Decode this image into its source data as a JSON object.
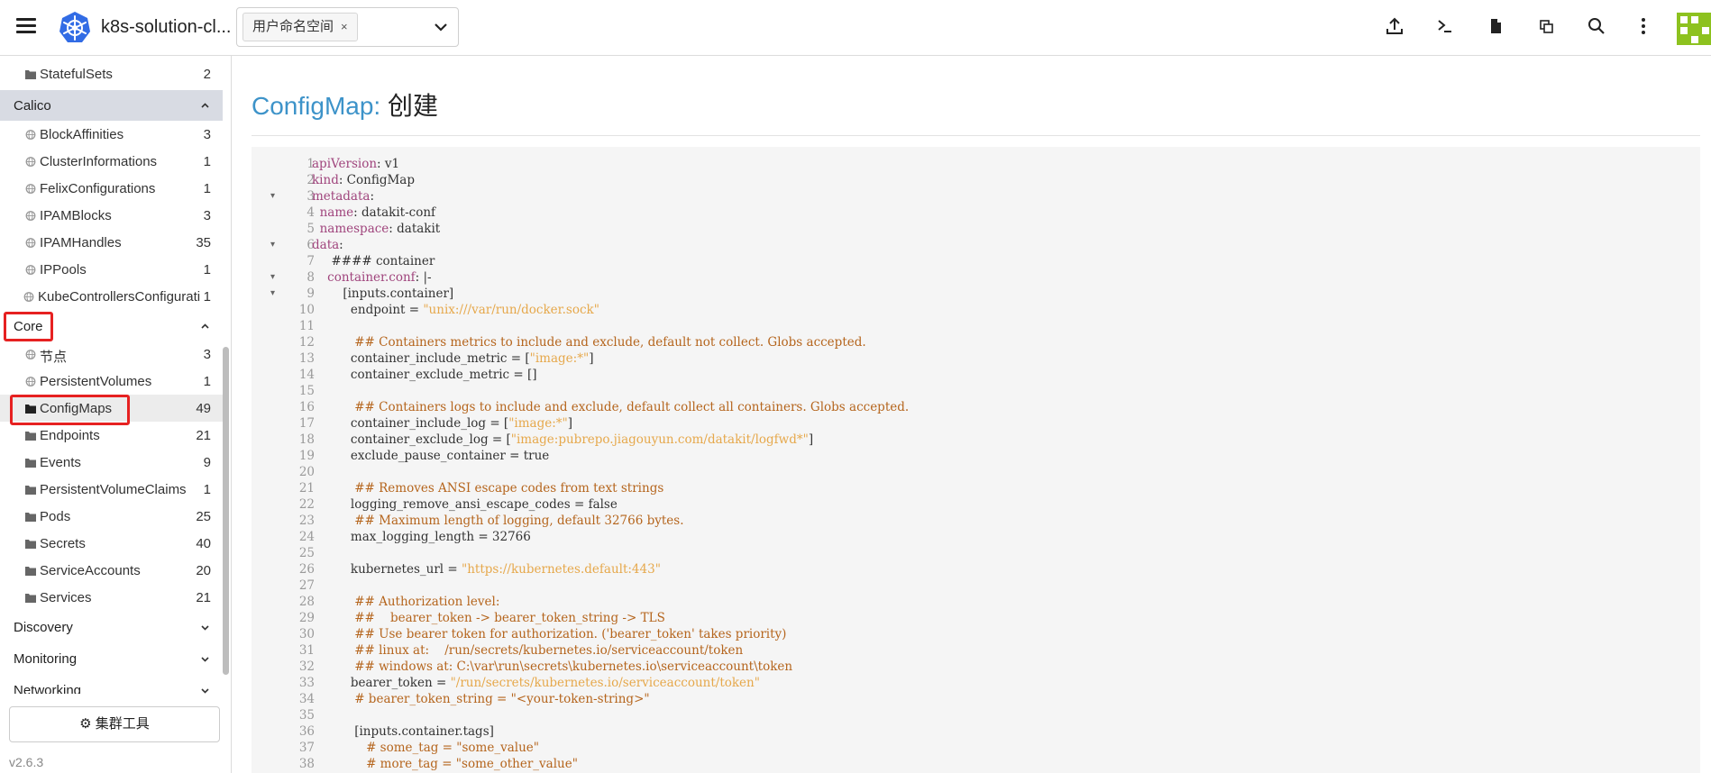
{
  "header": {
    "cluster_name": "k8s-solution-cl...",
    "namespace_chip": "用户命名空间",
    "chip_remove": "×"
  },
  "icons": {
    "menu": "hamburger-icon",
    "logo": "kubernetes-logo-icon",
    "upload": "upload-icon",
    "terminal": "terminal-icon",
    "file": "file-icon",
    "copy": "copy-icon",
    "search": "search-icon",
    "more": "more-vertical-icon"
  },
  "colors": {
    "accent": "#3d93c9",
    "highlight_box": "#e62121",
    "group_highlight": "#d8dbe3",
    "brand_tile": "#8dc21f"
  },
  "sidebar": {
    "top_item": {
      "label": "StatefulSets",
      "count": "2"
    },
    "groups": [
      {
        "label": "Calico",
        "items": [
          {
            "label": "BlockAffinities",
            "count": "3"
          },
          {
            "label": "ClusterInformations",
            "count": "1"
          },
          {
            "label": "FelixConfigurations",
            "count": "1"
          },
          {
            "label": "IPAMBlocks",
            "count": "3"
          },
          {
            "label": "IPAMHandles",
            "count": "35"
          },
          {
            "label": "IPPools",
            "count": "1"
          },
          {
            "label": "KubeControllersConfigurati",
            "count": "1"
          }
        ]
      },
      {
        "label": "Core",
        "items": [
          {
            "label": "节点",
            "count": "3"
          },
          {
            "label": "PersistentVolumes",
            "count": "1"
          },
          {
            "label": "ConfigMaps",
            "count": "49"
          },
          {
            "label": "Endpoints",
            "count": "21"
          },
          {
            "label": "Events",
            "count": "9"
          },
          {
            "label": "PersistentVolumeClaims",
            "count": "1"
          },
          {
            "label": "Pods",
            "count": "25"
          },
          {
            "label": "Secrets",
            "count": "40"
          },
          {
            "label": "ServiceAccounts",
            "count": "20"
          },
          {
            "label": "Services",
            "count": "21"
          }
        ]
      },
      {
        "label": "Discovery"
      },
      {
        "label": "Monitoring"
      },
      {
        "label": "Networking"
      }
    ],
    "tools_button": "集群工具",
    "version": "v2.6.3"
  },
  "main": {
    "title_kind": "ConfigMap:",
    "title_action": "创建"
  },
  "editor": {
    "lines": [
      {
        "n": "1",
        "fold": "",
        "segs": [
          [
            "k",
            "apiVersion"
          ],
          [
            "t",
            ": v1"
          ]
        ]
      },
      {
        "n": "2",
        "fold": "",
        "segs": [
          [
            "k",
            "kind"
          ],
          [
            "t",
            ": ConfigMap"
          ]
        ]
      },
      {
        "n": "3",
        "fold": "▾",
        "segs": [
          [
            "k",
            "metadata"
          ],
          [
            "t",
            ":"
          ]
        ]
      },
      {
        "n": "4",
        "fold": "",
        "segs": [
          [
            "t",
            "  "
          ],
          [
            "k",
            "name"
          ],
          [
            "t",
            ": datakit-conf"
          ]
        ]
      },
      {
        "n": "5",
        "fold": "",
        "segs": [
          [
            "t",
            "  "
          ],
          [
            "k",
            "namespace"
          ],
          [
            "t",
            ": datakit"
          ]
        ]
      },
      {
        "n": "6",
        "fold": "▾",
        "segs": [
          [
            "k",
            "data"
          ],
          [
            "t",
            ":"
          ]
        ]
      },
      {
        "n": "7",
        "fold": "",
        "segs": [
          [
            "t",
            "     #### container"
          ]
        ]
      },
      {
        "n": "8",
        "fold": "▾",
        "segs": [
          [
            "t",
            "    "
          ],
          [
            "k",
            "container.conf"
          ],
          [
            "t",
            ": |-"
          ]
        ]
      },
      {
        "n": "9",
        "fold": "▾",
        "segs": [
          [
            "t",
            "        [inputs.container]"
          ]
        ]
      },
      {
        "n": "10",
        "fold": "",
        "segs": [
          [
            "t",
            "          endpoint = "
          ],
          [
            "s",
            "\"unix:///var/run/docker.sock\""
          ]
        ]
      },
      {
        "n": "11",
        "fold": "",
        "segs": [
          [
            "t",
            ""
          ]
        ]
      },
      {
        "n": "12",
        "fold": "",
        "segs": [
          [
            "c",
            "           ## Containers metrics to include and exclude, default not collect. Globs accepted."
          ]
        ]
      },
      {
        "n": "13",
        "fold": "",
        "segs": [
          [
            "t",
            "          container_include_metric = ["
          ],
          [
            "s",
            "\"image:*\""
          ],
          [
            "t",
            "]"
          ]
        ]
      },
      {
        "n": "14",
        "fold": "",
        "segs": [
          [
            "t",
            "          container_exclude_metric = []"
          ]
        ]
      },
      {
        "n": "15",
        "fold": "",
        "segs": [
          [
            "t",
            ""
          ]
        ]
      },
      {
        "n": "16",
        "fold": "",
        "segs": [
          [
            "c",
            "           ## Containers logs to include and exclude, default collect all containers. Globs accepted."
          ]
        ]
      },
      {
        "n": "17",
        "fold": "",
        "segs": [
          [
            "t",
            "          container_include_log = ["
          ],
          [
            "s",
            "\"image:*\""
          ],
          [
            "t",
            "]"
          ]
        ]
      },
      {
        "n": "18",
        "fold": "",
        "segs": [
          [
            "t",
            "          container_exclude_log = ["
          ],
          [
            "s",
            "\"image:pubrepo.jiagouyun.com/datakit/logfwd*\""
          ],
          [
            "t",
            "]"
          ]
        ]
      },
      {
        "n": "19",
        "fold": "",
        "segs": [
          [
            "t",
            "          exclude_pause_container = true"
          ]
        ]
      },
      {
        "n": "20",
        "fold": "",
        "segs": [
          [
            "t",
            ""
          ]
        ]
      },
      {
        "n": "21",
        "fold": "",
        "segs": [
          [
            "c",
            "           ## Removes ANSI escape codes from text strings"
          ]
        ]
      },
      {
        "n": "22",
        "fold": "",
        "segs": [
          [
            "t",
            "          logging_remove_ansi_escape_codes = false"
          ]
        ]
      },
      {
        "n": "23",
        "fold": "",
        "segs": [
          [
            "c",
            "           ## Maximum length of logging, default 32766 bytes."
          ]
        ]
      },
      {
        "n": "24",
        "fold": "",
        "segs": [
          [
            "t",
            "          max_logging_length = 32766"
          ]
        ]
      },
      {
        "n": "25",
        "fold": "",
        "segs": [
          [
            "t",
            ""
          ]
        ]
      },
      {
        "n": "26",
        "fold": "",
        "segs": [
          [
            "t",
            "          kubernetes_url = "
          ],
          [
            "s",
            "\"https://kubernetes.default:443\""
          ]
        ]
      },
      {
        "n": "27",
        "fold": "",
        "segs": [
          [
            "t",
            ""
          ]
        ]
      },
      {
        "n": "28",
        "fold": "",
        "segs": [
          [
            "c",
            "           ## Authorization level:"
          ]
        ]
      },
      {
        "n": "29",
        "fold": "",
        "segs": [
          [
            "c",
            "           ##    bearer_token -> bearer_token_string -> TLS"
          ]
        ]
      },
      {
        "n": "30",
        "fold": "",
        "segs": [
          [
            "c",
            "           ## Use bearer token for authorization. ('bearer_token' takes priority)"
          ]
        ]
      },
      {
        "n": "31",
        "fold": "",
        "segs": [
          [
            "c",
            "           ## linux at:    /run/secrets/kubernetes.io/serviceaccount/token"
          ]
        ]
      },
      {
        "n": "32",
        "fold": "",
        "segs": [
          [
            "c",
            "           ## windows at: C:\\var\\run\\secrets\\kubernetes.io\\serviceaccount\\token"
          ]
        ]
      },
      {
        "n": "33",
        "fold": "",
        "segs": [
          [
            "t",
            "          bearer_token = "
          ],
          [
            "s",
            "\"/run/secrets/kubernetes.io/serviceaccount/token\""
          ]
        ]
      },
      {
        "n": "34",
        "fold": "",
        "segs": [
          [
            "c",
            "           # bearer_token_string = \"<your-token-string>\""
          ]
        ]
      },
      {
        "n": "35",
        "fold": "",
        "segs": [
          [
            "t",
            ""
          ]
        ]
      },
      {
        "n": "36",
        "fold": "",
        "segs": [
          [
            "t",
            "           [inputs.container.tags]"
          ]
        ]
      },
      {
        "n": "37",
        "fold": "",
        "segs": [
          [
            "c",
            "              # some_tag = \"some_value\""
          ]
        ]
      },
      {
        "n": "38",
        "fold": "",
        "segs": [
          [
            "c",
            "              # more_tag = \"some_other_value\""
          ]
        ]
      }
    ]
  }
}
